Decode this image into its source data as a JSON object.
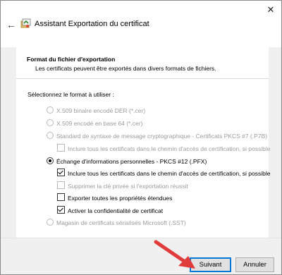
{
  "window": {
    "title": "Assistant Exportation du certificat",
    "close_glyph": "✕",
    "back_glyph": "←"
  },
  "header": {
    "title": "Format du fichier d'exportation",
    "subtitle": "Les certificats peuvent être exportés dans divers formats de fichiers."
  },
  "section_label": "Sélectionnez le format à utiliser :",
  "options": {
    "der": {
      "label": "X.509 binaire encodé DER (*.cer)",
      "selected": false,
      "enabled": false
    },
    "base64": {
      "label": "X.509 encodé en base 64 (*.cer)",
      "selected": false,
      "enabled": false
    },
    "pkcs7": {
      "label": "Standard de syntaxe de message cryptographique - Certificats PKCS #7 (.P7B)",
      "selected": false,
      "enabled": false
    },
    "pkcs7_include": {
      "label": "Inclure tous les certificats dans le chemin d'accès de certification, si possible",
      "checked": false,
      "enabled": false
    },
    "pfx": {
      "label": "Échange d'informations personnelles - PKCS #12 (.PFX)",
      "selected": true,
      "enabled": true
    },
    "pfx_include": {
      "label": "Inclure tous les certificats dans le chemin d'accès de certification, si possible",
      "checked": true
    },
    "pfx_delete": {
      "label": "Supprimer la clé privée si l'exportation réussit",
      "checked": false,
      "enabled": false
    },
    "pfx_export_props": {
      "label": "Exporter toutes les propriétés étendues",
      "checked": false
    },
    "pfx_privacy": {
      "label": "Activer la confidentialité de certificat",
      "checked": true
    },
    "sst": {
      "label": "Magasin de certificats sérialisés Microsoft (.SST)",
      "selected": false,
      "enabled": false
    }
  },
  "buttons": {
    "next": "Suivant",
    "cancel": "Annuler"
  },
  "colors": {
    "accent": "#0078d7",
    "arrow": "#e03c3c",
    "disabled_text": "#9b9b9b"
  }
}
